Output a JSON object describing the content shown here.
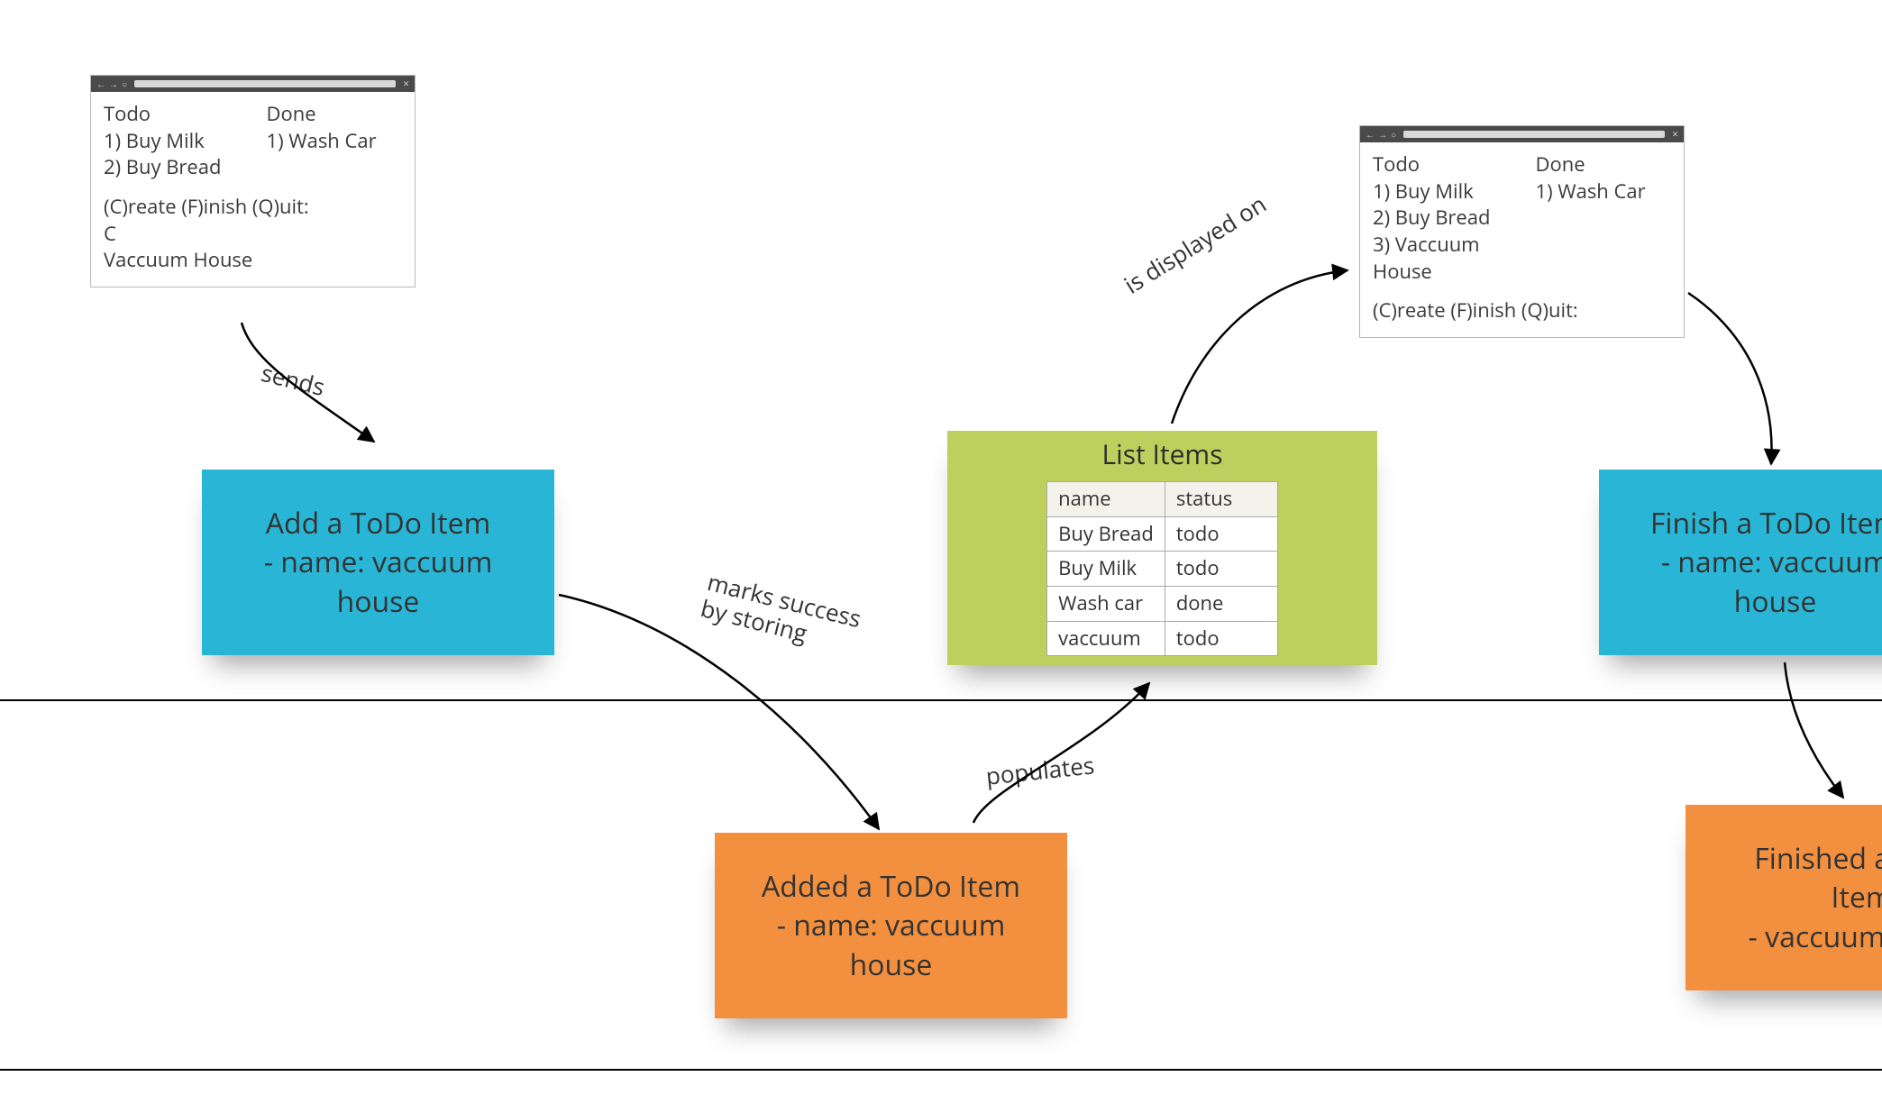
{
  "terminal_left": {
    "todo_header": "Todo",
    "todo_items": [
      "1) Buy Milk",
      "2) Buy Bread"
    ],
    "done_header": "Done",
    "done_items": [
      "1) Wash Car"
    ],
    "prompt": "(C)reate (F)inish (Q)uit:",
    "choice": "C",
    "entry": "Vaccuum House"
  },
  "terminal_right": {
    "todo_header": "Todo",
    "todo_items": [
      "1) Buy Milk",
      "2) Buy Bread",
      "3) Vaccuum House"
    ],
    "done_header": "Done",
    "done_items": [
      "1) Wash Car"
    ],
    "prompt": "(C)reate (F)inish (Q)uit:"
  },
  "notes": {
    "add_title": "Add a ToDo Item",
    "add_sub": "- name: vaccuum house",
    "added_title": "Added a ToDo Item",
    "added_sub": "- name: vaccuum house",
    "finish_title": "Finish a ToDo Item",
    "finish_sub": "- name: vaccuum house",
    "finished_title": "Finished a ToDo Item",
    "finished_sub": "- vaccuum house"
  },
  "list_card": {
    "title": "List Items",
    "columns": [
      "name",
      "status"
    ],
    "rows": [
      [
        "Buy Bread",
        "todo"
      ],
      [
        "Buy Milk",
        "todo"
      ],
      [
        "Wash car",
        "done"
      ],
      [
        "vaccuum",
        "todo"
      ]
    ]
  },
  "edges": {
    "sends": "sends",
    "marks": "marks success by storing",
    "populates": "populates",
    "displayed": "is displayed on"
  }
}
